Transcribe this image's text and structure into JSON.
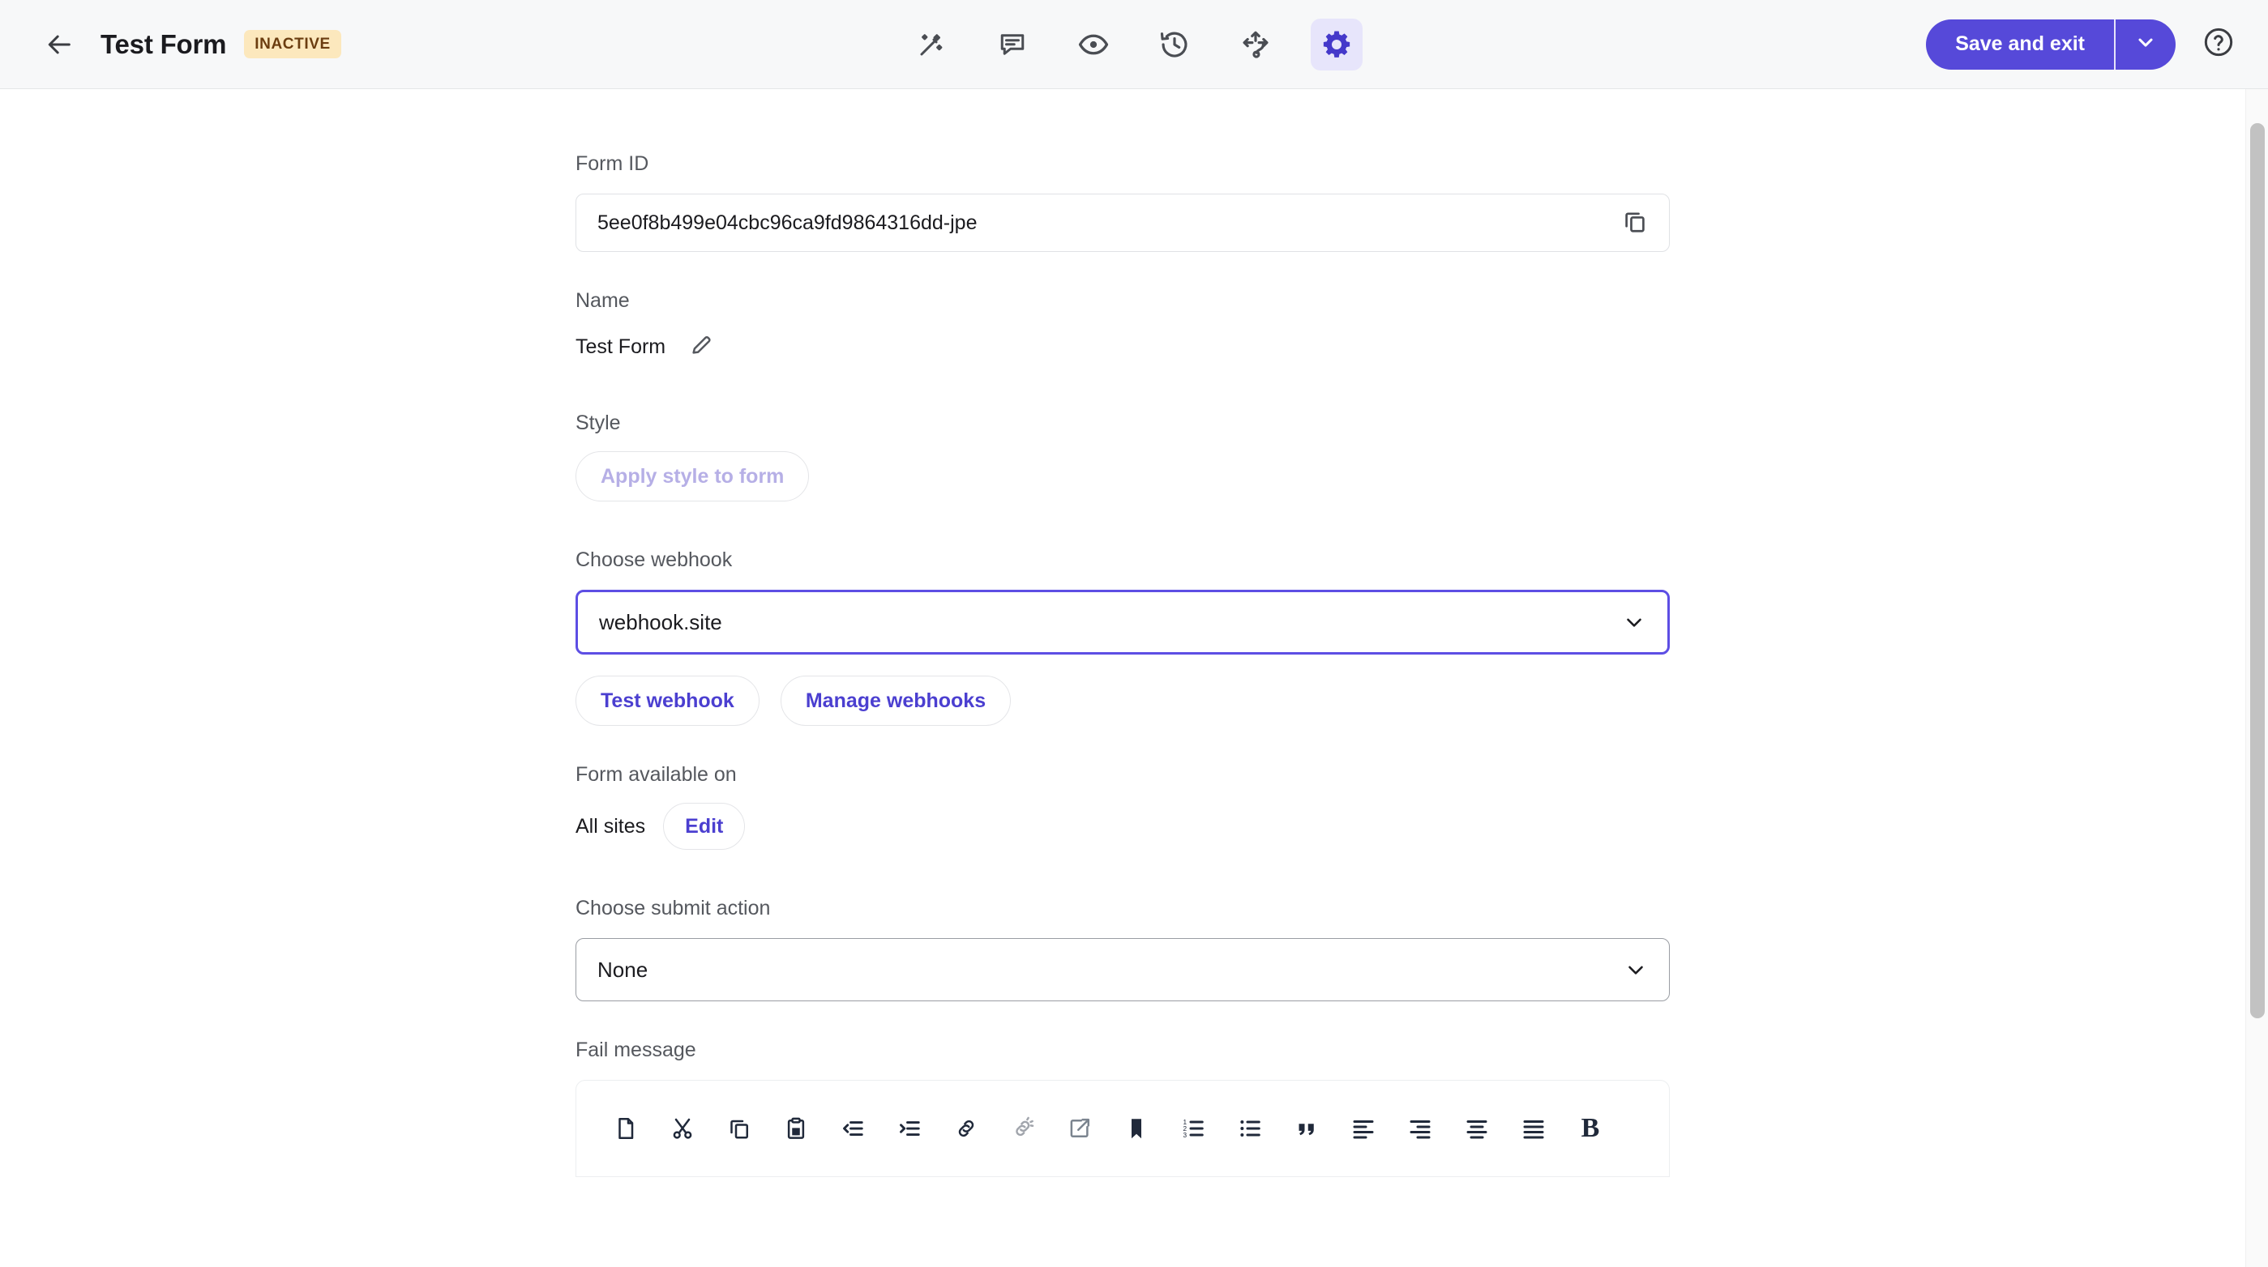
{
  "header": {
    "back_icon": "arrow-left-icon",
    "title": "Test Form",
    "status_badge": "INACTIVE",
    "tools": [
      {
        "name": "magic-wand-icon",
        "label": "Design"
      },
      {
        "name": "comment-icon",
        "label": "Comments"
      },
      {
        "name": "eye-icon",
        "label": "Preview"
      },
      {
        "name": "history-icon",
        "label": "History"
      },
      {
        "name": "routing-icon",
        "label": "Routing"
      },
      {
        "name": "gear-icon",
        "label": "Settings",
        "active": true
      }
    ],
    "save_label": "Save and exit",
    "save_caret_icon": "chevron-down-icon",
    "help_icon": "question-circle-icon",
    "accent_color": "#5649d9",
    "active_tool_bg": "#e7e5fb",
    "badge_bg": "#fce8bd",
    "badge_color": "#6b3d10"
  },
  "form": {
    "form_id": {
      "label": "Form ID",
      "value": "5ee0f8b499e04cbc96ca9fd9864316dd-jpe",
      "copy_icon": "copy-icon"
    },
    "name": {
      "label": "Name",
      "value": "Test Form",
      "edit_icon": "pencil-icon"
    },
    "style": {
      "label": "Style",
      "apply_button": "Apply style to form"
    },
    "webhook": {
      "label": "Choose webhook",
      "selected": "webhook.site",
      "caret_icon": "chevron-down-icon",
      "test_button": "Test webhook",
      "manage_button": "Manage webhooks"
    },
    "availability": {
      "label": "Form available on",
      "value": "All sites",
      "edit_button": "Edit"
    },
    "submit_action": {
      "label": "Choose submit action",
      "selected": "None",
      "caret_icon": "chevron-down-icon"
    },
    "fail_message": {
      "label": "Fail message",
      "toolbar": [
        {
          "name": "new-document-icon",
          "label": "New document"
        },
        {
          "name": "cut-scissors-icon",
          "label": "Cut"
        },
        {
          "name": "copy-icon",
          "label": "Copy"
        },
        {
          "name": "paste-text-icon",
          "label": "Paste as plain text"
        },
        {
          "name": "outdent-icon",
          "label": "Decrease indent"
        },
        {
          "name": "indent-icon",
          "label": "Increase indent"
        },
        {
          "name": "link-icon",
          "label": "Link"
        },
        {
          "name": "unlink-icon",
          "label": "Unlink",
          "disabled": true
        },
        {
          "name": "external-link-icon",
          "label": "Open link in new tab"
        },
        {
          "name": "anchor-bookmark-icon",
          "label": "Anchor"
        },
        {
          "name": "ordered-list-icon",
          "label": "Numbered list"
        },
        {
          "name": "unordered-list-icon",
          "label": "Bulleted list"
        },
        {
          "name": "blockquote-icon",
          "label": "Block quote"
        },
        {
          "name": "align-left-icon",
          "label": "Align left"
        },
        {
          "name": "align-right-icon",
          "label": "Align right"
        },
        {
          "name": "align-center-icon",
          "label": "Align center"
        },
        {
          "name": "justify-icon",
          "label": "Justify"
        },
        {
          "name": "bold-icon",
          "label": "B"
        }
      ]
    }
  },
  "scrollbar": {
    "name": "vertical-scrollbar"
  }
}
